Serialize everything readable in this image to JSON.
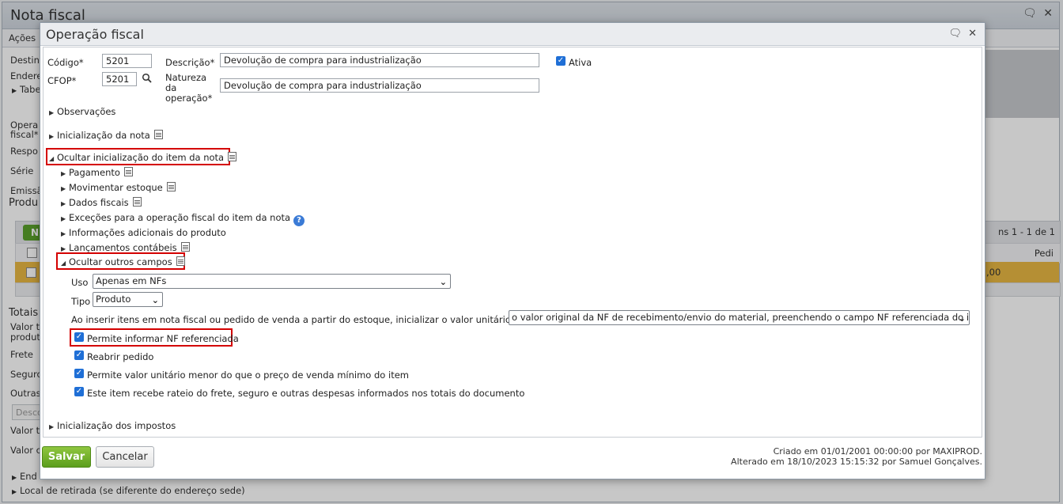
{
  "background": {
    "window_title": "Nota fiscal",
    "menu_first": "Ações",
    "labels": [
      "Destin",
      "Endere",
      "Tabe",
      "Opera",
      "fiscal*",
      "Respo",
      "Série",
      "Emissã",
      "Produ",
      "Totais",
      "Valor t",
      "produt",
      "Frete",
      "Seguro",
      "Outras",
      "Valor t",
      "Valor c",
      "End"
    ],
    "desc_placeholder": "Desco",
    "grid_new_button": "N",
    "grid_paging": "ns 1 - 1 de 1",
    "grid_col": "Pedi",
    "grid_value": ",00",
    "bottom_link": "Local de retirada (se diferente do endereço sede)"
  },
  "modal": {
    "title": "Operação fiscal",
    "fields": {
      "codigo_label": "Código*",
      "codigo_value": "5201",
      "descricao_label": "Descrição*",
      "descricao_value": "Devolução de compra para industrialização",
      "ativa_label": "Ativa",
      "cfop_label": "CFOP*",
      "cfop_value": "5201",
      "natureza_label_1": "Natureza",
      "natureza_label_2": "da",
      "natureza_label_3": "operação*",
      "natureza_value": "Devolução de compra para industrialização"
    },
    "sections": {
      "observacoes": "Observações",
      "inicializacao_nota": "Inicialização da nota",
      "ocultar_item": "Ocultar inicialização do item da nota",
      "pagamento": "Pagamento",
      "movimentar_estoque": "Movimentar estoque",
      "dados_fiscais": "Dados fiscais",
      "excecoes": "Exceções para a operação fiscal do item da nota",
      "info_adicionais": "Informações adicionais do produto",
      "lancamentos": "Lançamentos contábeis",
      "ocultar_outros": "Ocultar outros campos",
      "inicializacao_impostos": "Inicialização dos impostos"
    },
    "outros": {
      "uso_label": "Uso",
      "uso_value": "Apenas em NFs",
      "tipo_label": "Tipo",
      "tipo_value": "Produto",
      "valor_label": "Ao inserir itens em nota fiscal ou pedido de venda a partir do estoque, inicializar o valor unitário com:",
      "valor_value": "o valor original da NF de recebimento/envio do material, preenchendo o campo NF referenciada do item",
      "checkboxes": [
        "Permite informar NF referenciada",
        "Reabrir pedido",
        "Permite valor unitário menor do que o preço de venda mínimo do item",
        "Este item recebe rateio do frete, seguro e outras despesas informados nos totais do documento"
      ]
    },
    "buttons": {
      "save": "Salvar",
      "cancel": "Cancelar"
    },
    "footer": {
      "created": "Criado em 01/01/2001 00:00:00 por MAXIPROD.",
      "altered": "Alterado em 18/10/2023 15:15:32 por Samuel Gonçalves."
    }
  }
}
